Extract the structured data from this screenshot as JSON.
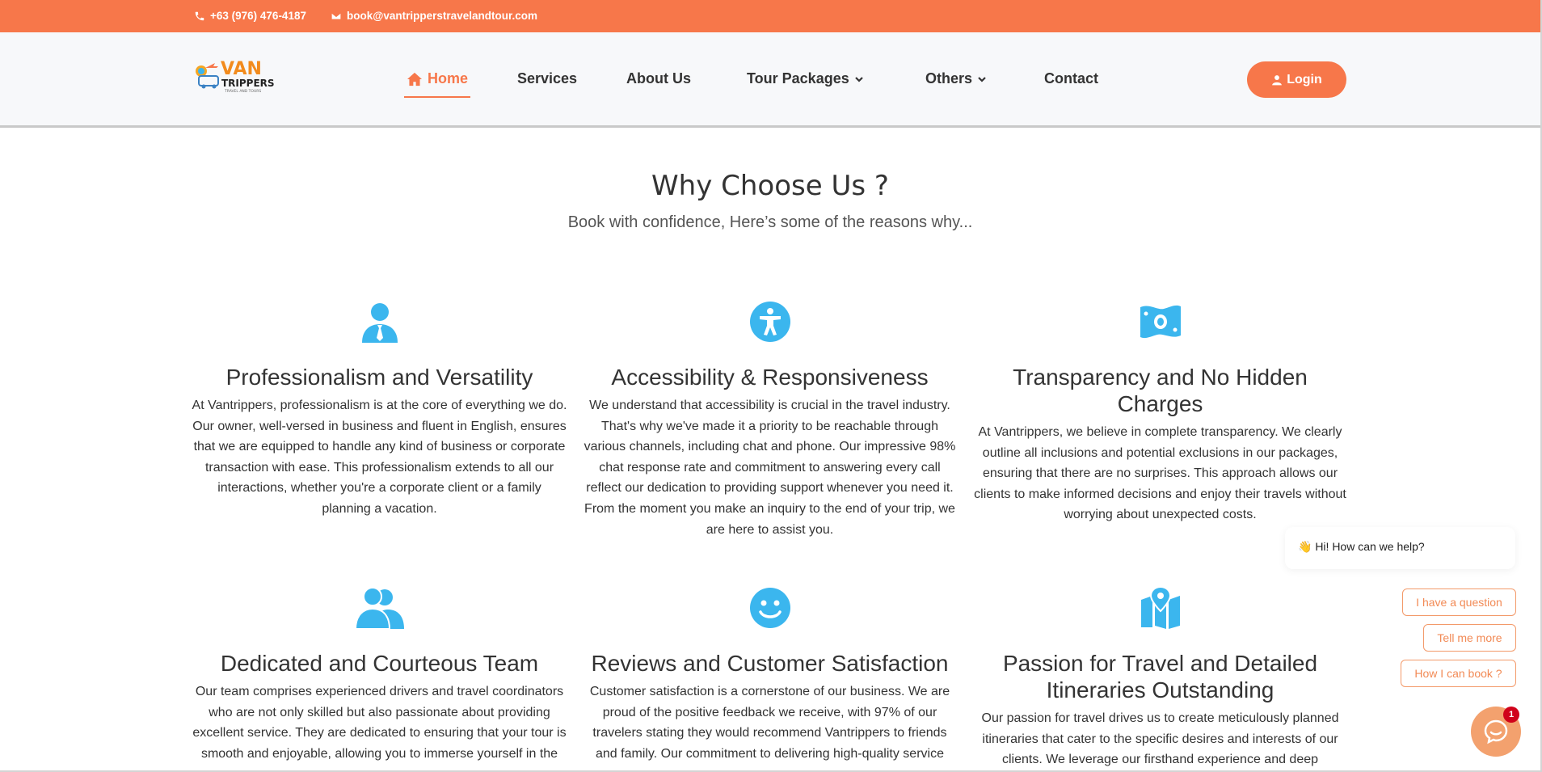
{
  "topbar": {
    "phone": "+63 (976) 476-4187",
    "email": "book@vantripperstravelandtour.com",
    "phone_icon": "phone-icon",
    "email_icon": "envelope-icon",
    "background": "#f7774a"
  },
  "logo": {
    "word_top": "VAN",
    "word_main": "TRIPPERS",
    "tagline": "TRAVEL AND TOURS"
  },
  "nav": {
    "items": [
      {
        "label": "Home",
        "active": true,
        "icon": "home-icon"
      },
      {
        "label": "Services"
      },
      {
        "label": "About Us"
      },
      {
        "label": "Tour Packages",
        "dropdown": true
      },
      {
        "label": "Others",
        "dropdown": true
      },
      {
        "label": "Contact"
      }
    ],
    "login_label": "Login",
    "accent": "#f7774a"
  },
  "section": {
    "title": "Why Choose Us ?",
    "subtitle": "Book with confidence, Here’s some of the reasons why..."
  },
  "features": [
    {
      "icon": "user-tie-icon",
      "title": "Professionalism and Versatility",
      "text": "At Vantrippers, professionalism is at the core of everything we do. Our owner, well-versed in business and fluent in English, ensures that we are equipped to handle any kind of business or corporate transaction with ease. This professionalism extends to all our interactions, whether you're a corporate client or a family planning a vacation."
    },
    {
      "icon": "accessibility-icon",
      "title": "Accessibility & Responsiveness",
      "text": "We understand that accessibility is crucial in the travel industry. That's why we've made it a priority to be reachable through various channels, including chat and phone. Our impressive 98% chat response rate and commitment to answering every call reflect our dedication to providing support whenever you need it. From the moment you make an inquiry to the end of your trip, we are here to assist you."
    },
    {
      "icon": "money-bill-icon",
      "title": "Transparency and No Hidden Charges",
      "text": "At Vantrippers, we believe in complete transparency. We clearly outline all inclusions and potential exclusions in our packages, ensuring that there are no surprises. This approach allows our clients to make informed decisions and enjoy their travels without worrying about unexpected costs."
    },
    {
      "icon": "users-icon",
      "title": "Dedicated and Courteous Team",
      "text": "Our team comprises experienced drivers and travel coordinators who are not only skilled but also passionate about providing excellent service. They are dedicated to ensuring that your tour is smooth and enjoyable, allowing you to immerse yourself in the"
    },
    {
      "icon": "smile-icon",
      "title": "Reviews and Customer Satisfaction",
      "text": "Customer satisfaction is a cornerstone of our business. We are proud of the positive feedback we receive, with 97% of our travelers stating they would recommend Vantrippers to friends and family. Our commitment to delivering high-quality service"
    },
    {
      "icon": "map-location-icon",
      "title": "Passion for Travel and Detailed Itineraries Outstanding",
      "text": "Our passion for travel drives us to create meticulously planned itineraries that cater to the specific desires and interests of our clients. We leverage our firsthand experience and deep"
    }
  ],
  "chat": {
    "greeting": "👋 Hi! How can we help?",
    "options": [
      "I have a question",
      "Tell me more",
      "How I can book ?"
    ],
    "badge_count": "1",
    "icon": "chat-icon"
  },
  "colors": {
    "accent": "#f7774a",
    "feature_icon": "#3bb6ee"
  }
}
